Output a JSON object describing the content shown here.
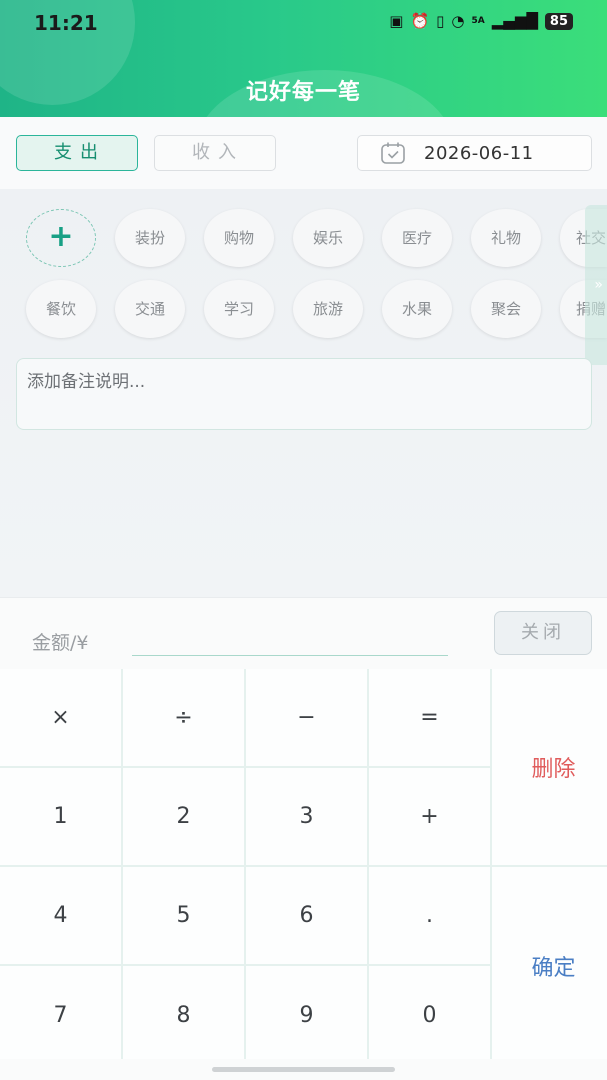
{
  "status_bar": {
    "time": "11:21",
    "icons": [
      "nfc-icon",
      "alarm-icon",
      "vibrate-icon",
      "wifi-icon",
      "signal-icon"
    ],
    "network": "5A",
    "battery": "85"
  },
  "header": {
    "title": "记好每一笔"
  },
  "type_toggle": {
    "expense": "支出",
    "income": "收入",
    "active": "expense"
  },
  "date": {
    "value": "2026-06-11"
  },
  "categories": {
    "add_label": "+",
    "row1": [
      "装扮",
      "购物",
      "娱乐",
      "医疗",
      "礼物",
      "社交"
    ],
    "row2": [
      "餐饮",
      "交通",
      "学习",
      "旅游",
      "水果",
      "聚会",
      "捐赠"
    ],
    "side_arrow": "»"
  },
  "note": {
    "placeholder": "添加备注说明..."
  },
  "amount": {
    "label": "金额/¥",
    "value": "",
    "close": "关闭"
  },
  "keypad": {
    "keys": [
      "×",
      "÷",
      "−",
      "=",
      "1",
      "2",
      "3",
      "+",
      "4",
      "5",
      "6",
      ".",
      "7",
      "8",
      "9",
      "0"
    ],
    "delete": "删除",
    "confirm": "确定"
  },
  "colors": {
    "primary": "#2bb59a",
    "header_start": "#1fb487",
    "header_end": "#3bde7a",
    "delete": "#e05c5c",
    "confirm": "#4a7ec4"
  }
}
